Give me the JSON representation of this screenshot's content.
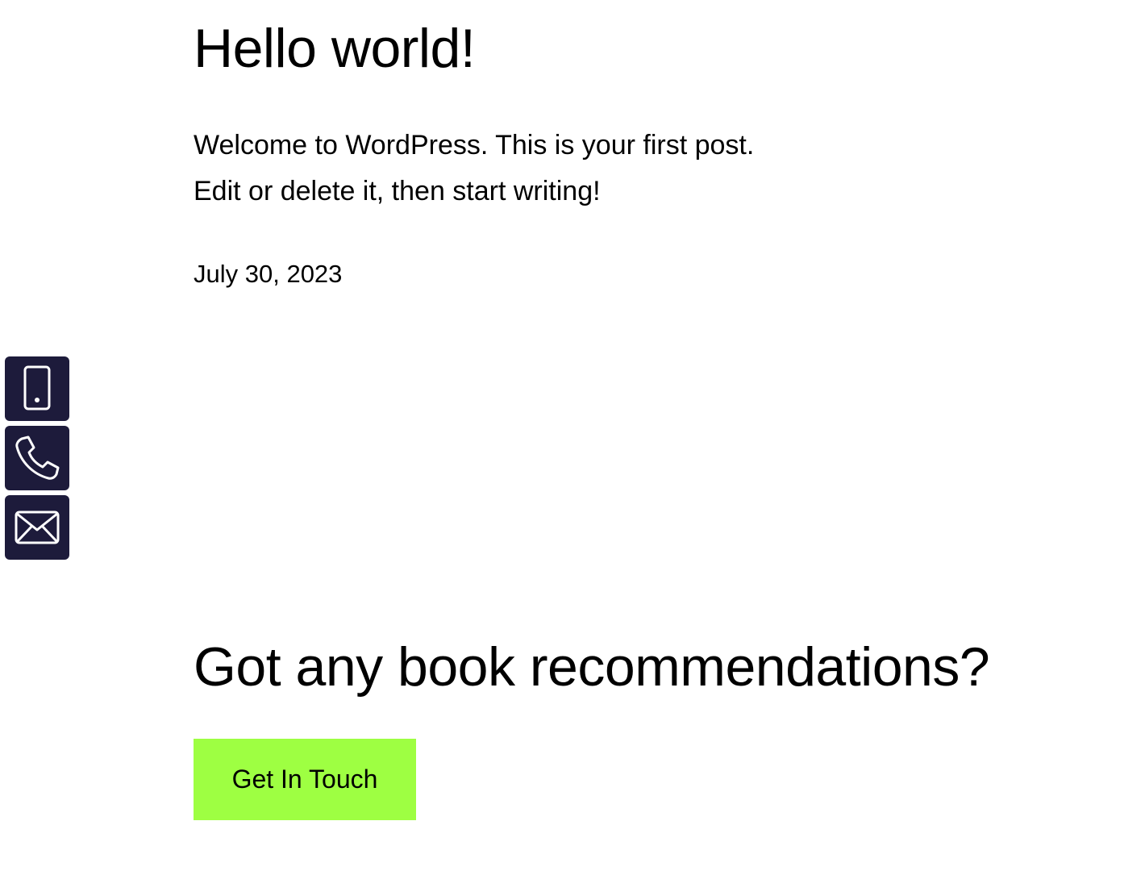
{
  "post": {
    "title": "Hello world!",
    "body_lines": [
      "Welcome to WordPress. This is your first post.",
      "Edit or delete it, then start writing!"
    ],
    "date": "July 30, 2023"
  },
  "cta": {
    "heading": "Got any book recommendations?",
    "button_label": "Get In Touch",
    "button_color": "#9eff42"
  },
  "contact_bar": {
    "background_color": "#1d1b3b",
    "items": [
      {
        "icon": "mobile-phone-icon"
      },
      {
        "icon": "phone-icon"
      },
      {
        "icon": "envelope-icon"
      }
    ]
  }
}
